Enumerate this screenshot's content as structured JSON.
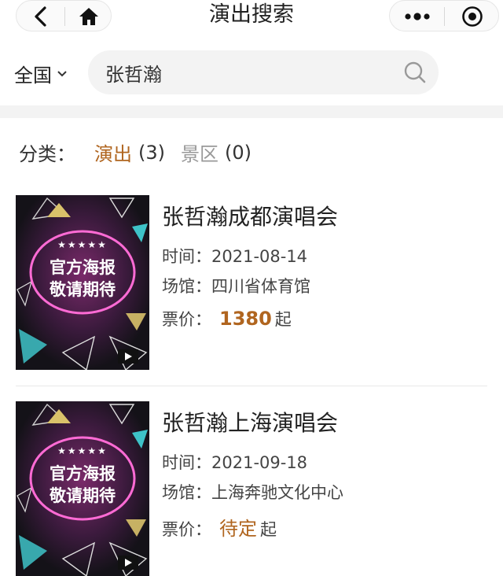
{
  "nav": {
    "title": "演出搜索",
    "icons": [
      "back-icon",
      "home-icon",
      "more-icon",
      "close-target-icon"
    ]
  },
  "search": {
    "region": "全国",
    "query": "张哲瀚"
  },
  "filter": {
    "label": "分类：",
    "categories": [
      {
        "name": "演出",
        "count": "(3)",
        "active": true
      },
      {
        "name": "景区",
        "count": "(0)",
        "active": false
      }
    ]
  },
  "poster": {
    "stars": "★★★★★",
    "line1": "官方海报",
    "line2": "敬请期待"
  },
  "events": [
    {
      "title": "张哲瀚成都演唱会",
      "time_label": "时间：",
      "time": "2021-08-14",
      "venue_label": "场馆：",
      "venue": "四川省体育馆",
      "price_label": "票价：",
      "price": "1380",
      "price_suffix": "起"
    },
    {
      "title": "张哲瀚上海演唱会",
      "time_label": "时间：",
      "time": "2021-09-18",
      "venue_label": "场馆：",
      "venue": "上海奔驰文化中心",
      "price_label": "票价：",
      "price": "待定",
      "price_suffix": "起"
    }
  ],
  "colors": {
    "accent": "#b0651f",
    "muted": "#999999",
    "band": "#f3f3f3"
  }
}
